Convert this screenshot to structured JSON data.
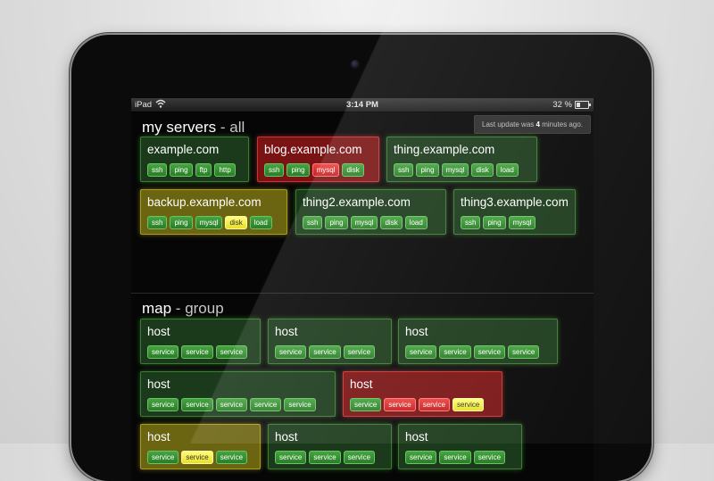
{
  "statusbar": {
    "carrier": "iPad",
    "time": "3:14 PM",
    "battery_pct": "32 %"
  },
  "update_notice": {
    "prefix": "Last update was",
    "value": "4",
    "suffix": "minutes ago."
  },
  "sections": [
    {
      "title": "my servers",
      "subtitle": "all",
      "cards": [
        {
          "name": "example.com",
          "status": "green",
          "tags": [
            {
              "label": "ssh",
              "s": "g"
            },
            {
              "label": "ping",
              "s": "g"
            },
            {
              "label": "ftp",
              "s": "g"
            },
            {
              "label": "http",
              "s": "g"
            }
          ]
        },
        {
          "name": "blog.example.com",
          "status": "red",
          "tags": [
            {
              "label": "ssh",
              "s": "g"
            },
            {
              "label": "ping",
              "s": "g"
            },
            {
              "label": "mysql",
              "s": "r"
            },
            {
              "label": "disk",
              "s": "g"
            }
          ]
        },
        {
          "name": "thing.example.com",
          "status": "green",
          "tags": [
            {
              "label": "ssh",
              "s": "g"
            },
            {
              "label": "ping",
              "s": "g"
            },
            {
              "label": "mysql",
              "s": "g"
            },
            {
              "label": "disk",
              "s": "g"
            },
            {
              "label": "load",
              "s": "g"
            }
          ]
        },
        {
          "name": "backup.example.com",
          "status": "yellow",
          "tags": [
            {
              "label": "ssh",
              "s": "g"
            },
            {
              "label": "ping",
              "s": "g"
            },
            {
              "label": "mysql",
              "s": "g"
            },
            {
              "label": "disk",
              "s": "y"
            },
            {
              "label": "load",
              "s": "g"
            }
          ]
        },
        {
          "name": "thing2.example.com",
          "status": "green",
          "tags": [
            {
              "label": "ssh",
              "s": "g"
            },
            {
              "label": "ping",
              "s": "g"
            },
            {
              "label": "mysql",
              "s": "g"
            },
            {
              "label": "disk",
              "s": "g"
            },
            {
              "label": "load",
              "s": "g"
            }
          ]
        },
        {
          "name": "thing3.example.com",
          "status": "green",
          "tags": [
            {
              "label": "ssh",
              "s": "g"
            },
            {
              "label": "ping",
              "s": "g"
            },
            {
              "label": "mysql",
              "s": "g"
            }
          ]
        }
      ]
    },
    {
      "title": "map",
      "subtitle": "group",
      "cards": [
        {
          "name": "host",
          "status": "green",
          "tags": [
            {
              "label": "service",
              "s": "g"
            },
            {
              "label": "service",
              "s": "g"
            },
            {
              "label": "service",
              "s": "g"
            }
          ]
        },
        {
          "name": "host",
          "status": "green",
          "tags": [
            {
              "label": "service",
              "s": "g"
            },
            {
              "label": "service",
              "s": "g"
            },
            {
              "label": "service",
              "s": "g"
            }
          ]
        },
        {
          "name": "host",
          "status": "green",
          "tags": [
            {
              "label": "service",
              "s": "g"
            },
            {
              "label": "service",
              "s": "g"
            },
            {
              "label": "service",
              "s": "g"
            },
            {
              "label": "service",
              "s": "g"
            }
          ]
        },
        {
          "name": "host",
          "status": "green",
          "tags": [
            {
              "label": "service",
              "s": "g"
            },
            {
              "label": "service",
              "s": "g"
            },
            {
              "label": "service",
              "s": "g"
            },
            {
              "label": "service",
              "s": "g"
            },
            {
              "label": "service",
              "s": "g"
            }
          ]
        },
        {
          "name": "host",
          "status": "red",
          "tags": [
            {
              "label": "service",
              "s": "g"
            },
            {
              "label": "service",
              "s": "r"
            },
            {
              "label": "service",
              "s": "r"
            },
            {
              "label": "service",
              "s": "y"
            }
          ]
        },
        {
          "name": "host",
          "status": "yellow",
          "tags": [
            {
              "label": "service",
              "s": "g"
            },
            {
              "label": "service",
              "s": "y"
            },
            {
              "label": "service",
              "s": "g"
            }
          ]
        },
        {
          "name": "host",
          "status": "green",
          "tags": [
            {
              "label": "service",
              "s": "g"
            },
            {
              "label": "service",
              "s": "g"
            },
            {
              "label": "service",
              "s": "g"
            }
          ]
        },
        {
          "name": "host",
          "status": "green",
          "tags": [
            {
              "label": "service",
              "s": "g"
            },
            {
              "label": "service",
              "s": "g"
            },
            {
              "label": "service",
              "s": "g"
            }
          ]
        }
      ]
    }
  ],
  "colors": {
    "ok": "#2a7d27",
    "critical": "#c41f1f",
    "warning": "#e8df27"
  }
}
